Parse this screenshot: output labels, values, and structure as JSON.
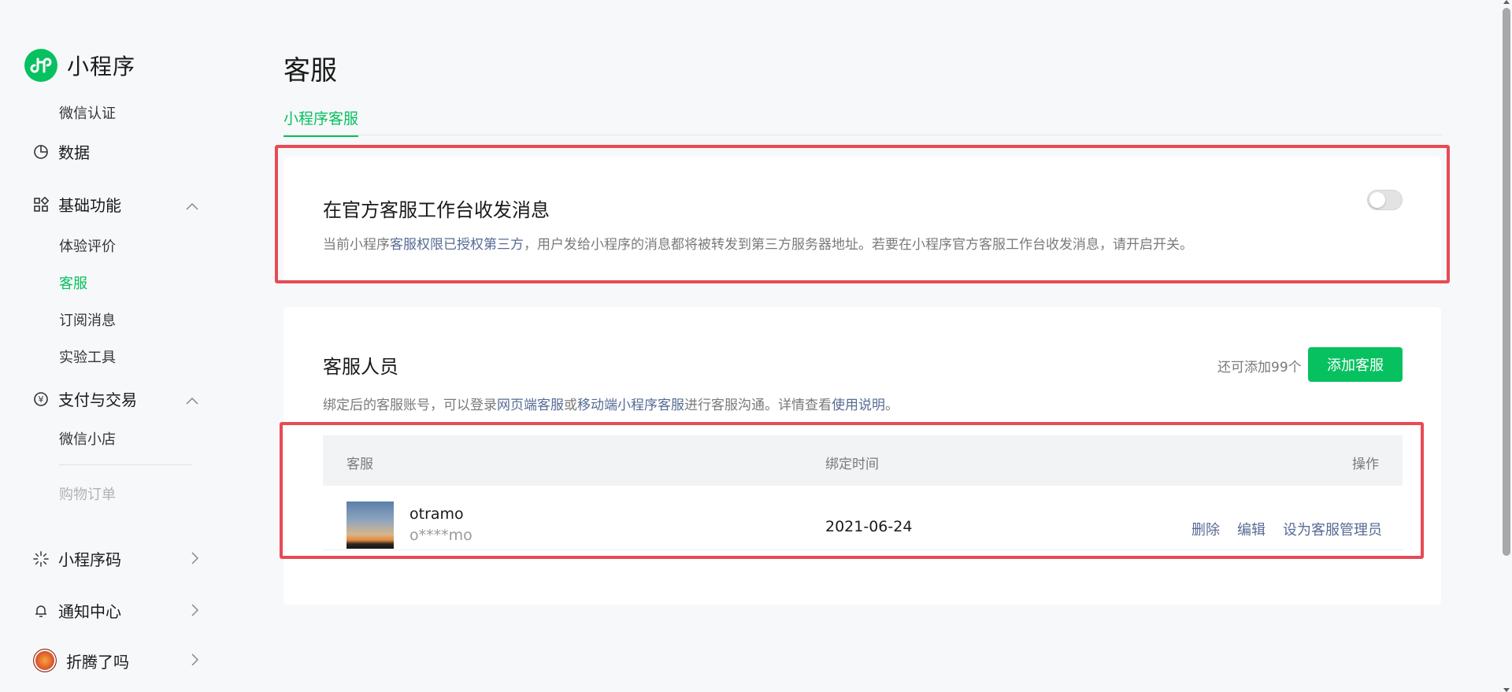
{
  "app": {
    "name": "小程序"
  },
  "sidebar": {
    "items": [
      {
        "label": "微信认证"
      },
      {
        "label": "数据",
        "icon": "pie-chart-icon"
      },
      {
        "label": "基础功能",
        "icon": "grid-icon",
        "expanded": true
      },
      {
        "label": "体验评价"
      },
      {
        "label": "客服",
        "active": true
      },
      {
        "label": "订阅消息"
      },
      {
        "label": "实验工具"
      },
      {
        "label": "支付与交易",
        "icon": "yen-icon",
        "expanded": true
      },
      {
        "label": "微信小店"
      },
      {
        "label": "购物订单",
        "disabled": true
      },
      {
        "label": "小程序码",
        "icon": "qrcode-icon"
      },
      {
        "label": "通知中心",
        "icon": "bell-icon"
      },
      {
        "label": "折腾了吗",
        "icon": "user-avatar"
      }
    ]
  },
  "page": {
    "title": "客服"
  },
  "tabs": [
    {
      "label": "小程序客服",
      "active": true
    }
  ],
  "official_card": {
    "title": "在官方客服工作台收发消息",
    "desc_pre": "当前小程序",
    "desc_link": "客服权限已授权第三方",
    "desc_post": "，用户发给小程序的消息都将被转发到第三方服务器地址。若要在小程序官方客服工作台收发消息，请开启开关。",
    "toggle_on": false
  },
  "staff_card": {
    "title": "客服人员",
    "quota": "还可添加99个",
    "add_button": "添加客服",
    "desc_1": "绑定后的客服账号，可以登录",
    "link_1": "网页端客服",
    "desc_2": "或",
    "link_2": "移动端小程序客服",
    "desc_3": "进行客服沟通。详情查看",
    "link_3": "使用说明",
    "desc_4": "。",
    "table": {
      "headers": [
        "客服",
        "绑定时间",
        "操作"
      ],
      "rows": [
        {
          "name": "otramo",
          "id": "o****mo",
          "bind_time": "2021-06-24",
          "actions": [
            "删除",
            "编辑",
            "设为客服管理员"
          ]
        }
      ]
    }
  },
  "colors": {
    "accent": "#07c160",
    "link": "#576b95",
    "highlight": "#e84b54"
  }
}
